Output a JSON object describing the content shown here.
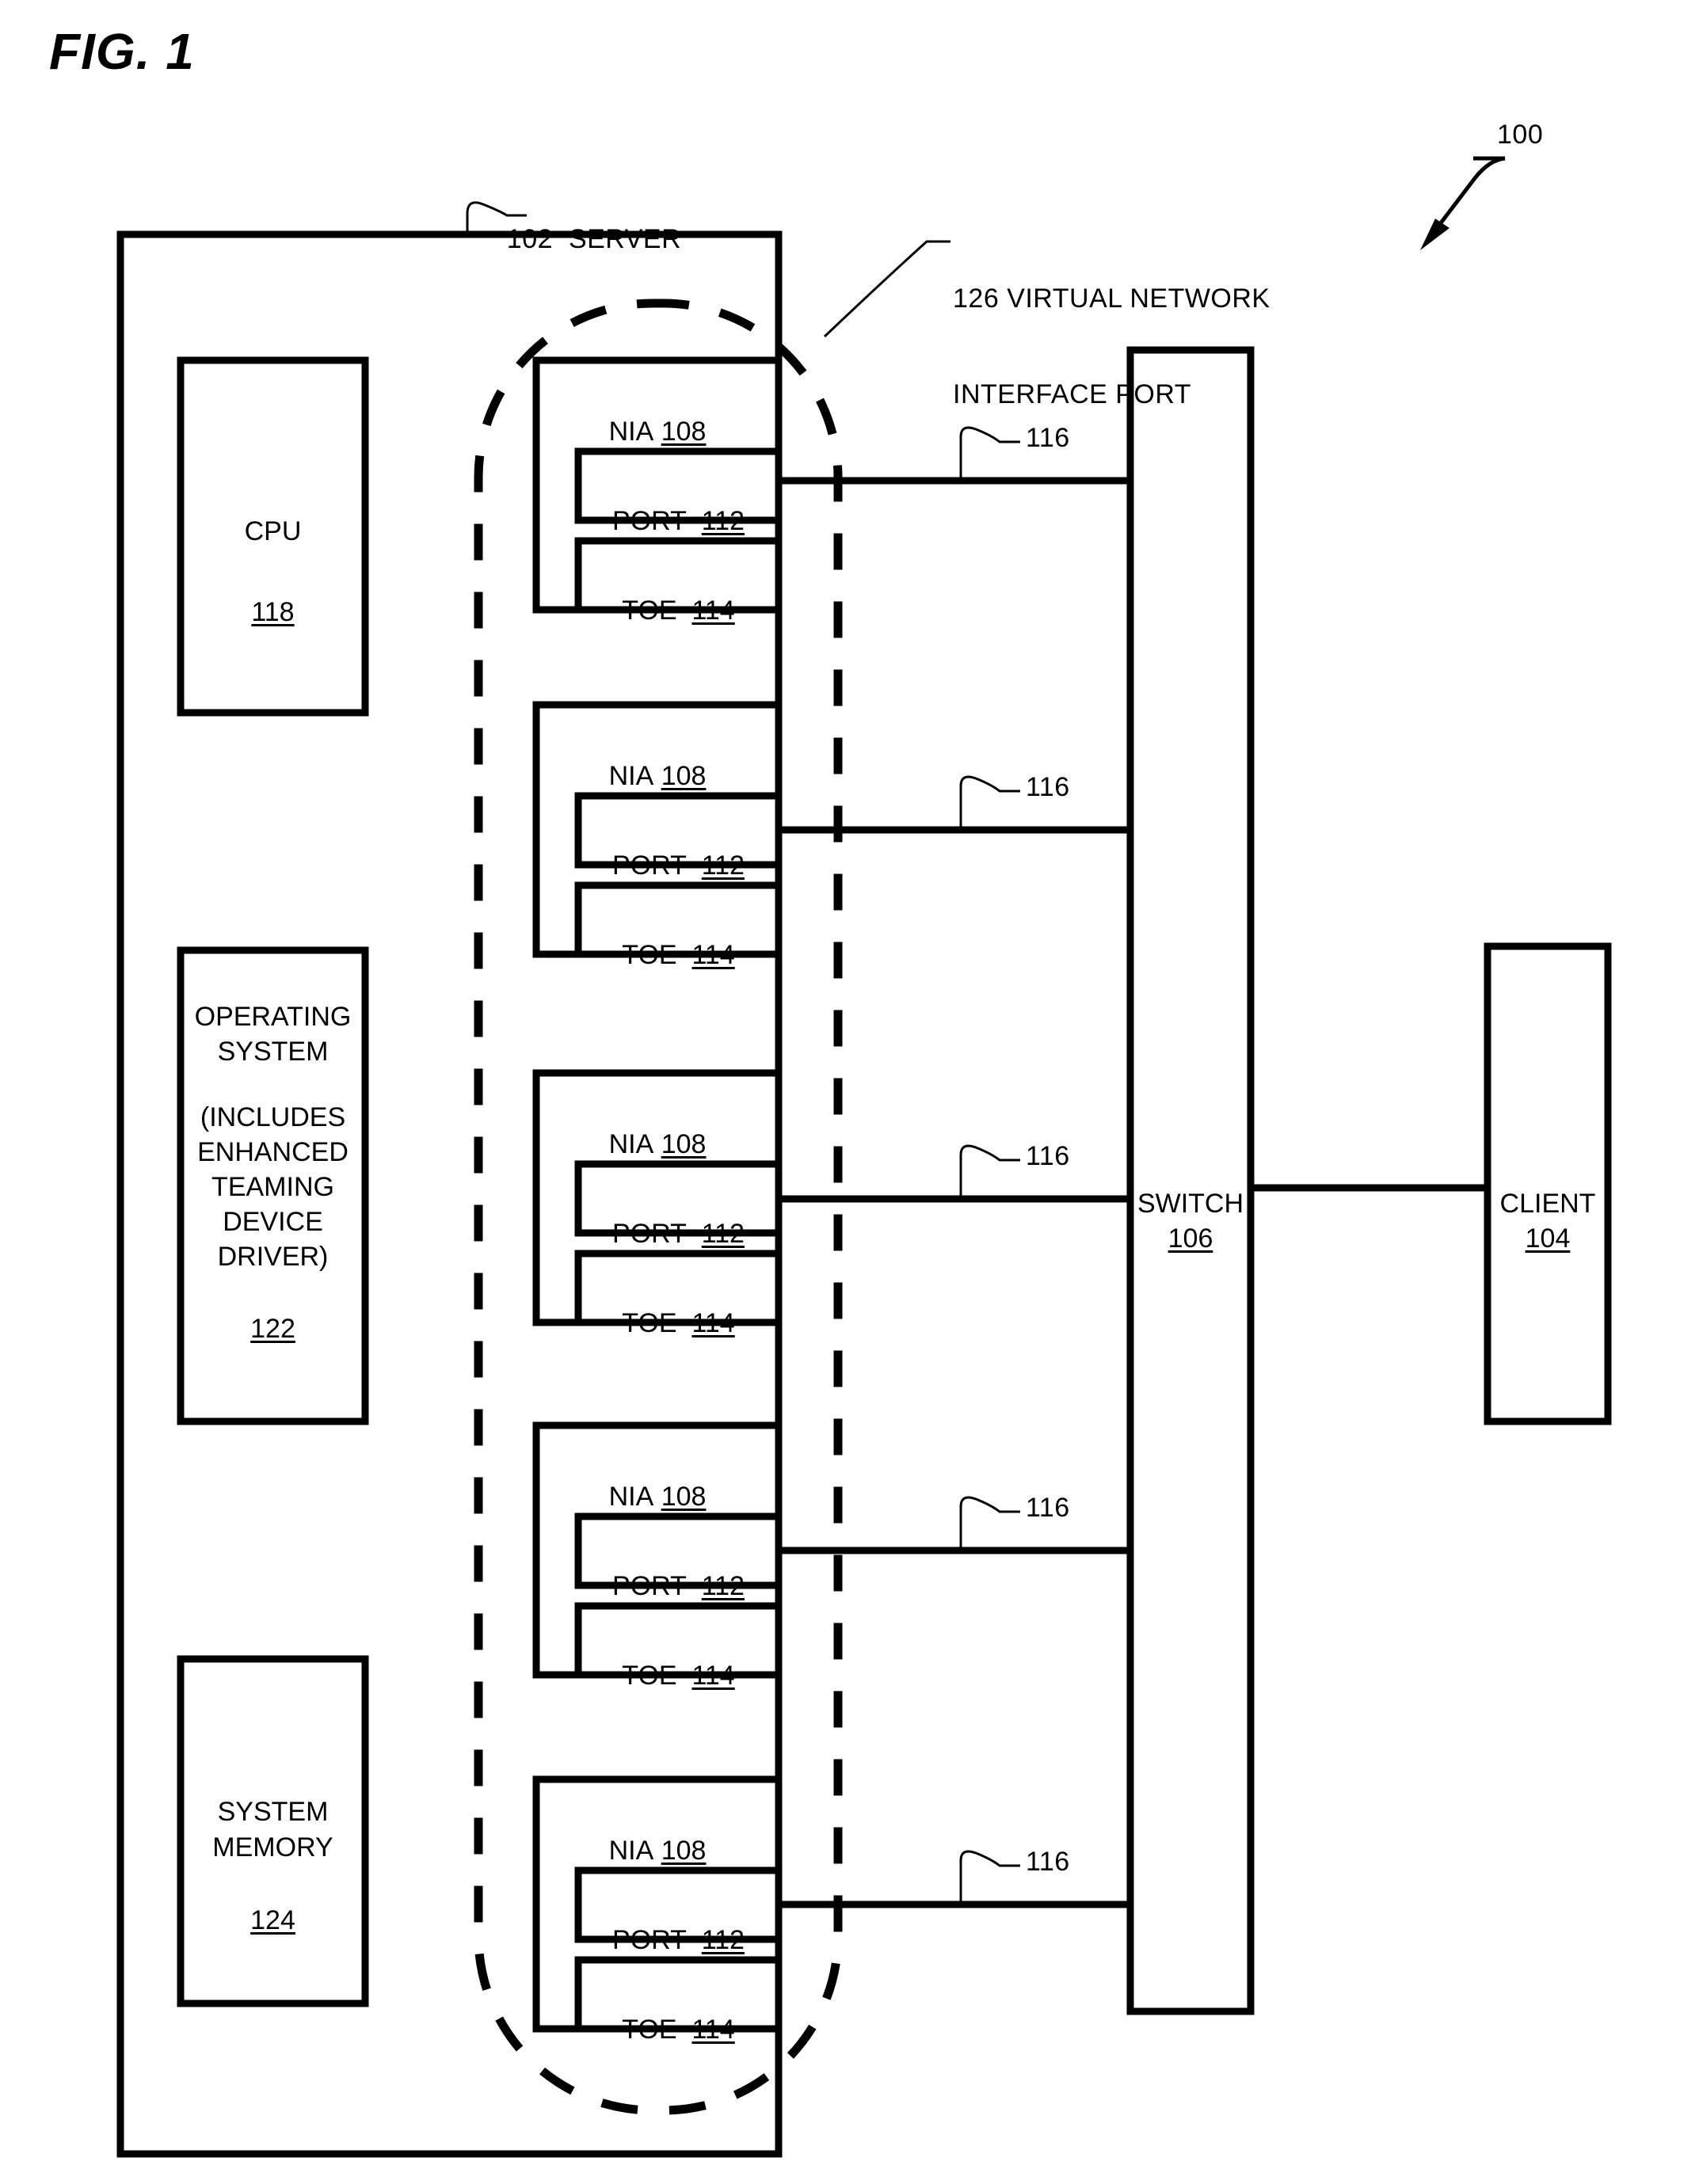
{
  "figure": {
    "label": "FIG. 1",
    "system_ref": "100"
  },
  "callouts": {
    "server": {
      "ref": "102",
      "text": "SERVER"
    },
    "vnip": {
      "ref": "126",
      "line1": "VIRTUAL NETWORK",
      "line2": "INTERFACE PORT"
    }
  },
  "server": {
    "cpu": {
      "label": "CPU",
      "ref": "118"
    },
    "os": {
      "line1": "OPERATING",
      "line2": "SYSTEM",
      "line3": "(INCLUDES",
      "line4": "ENHANCED",
      "line5": "TEAMING",
      "line6": "DEVICE",
      "line7": "DRIVER)",
      "ref": "122"
    },
    "memory": {
      "line1": "SYSTEM",
      "line2": "MEMORY",
      "ref": "124"
    },
    "nias": [
      {
        "label": "NIA",
        "ref": "108",
        "port": {
          "label": "PORT",
          "ref": "112"
        },
        "toe": {
          "label": "TOE",
          "ref": "114"
        },
        "link_ref": "116"
      },
      {
        "label": "NIA",
        "ref": "108",
        "port": {
          "label": "PORT",
          "ref": "112"
        },
        "toe": {
          "label": "TOE",
          "ref": "114"
        },
        "link_ref": "116"
      },
      {
        "label": "NIA",
        "ref": "108",
        "port": {
          "label": "PORT",
          "ref": "112"
        },
        "toe": {
          "label": "TOE",
          "ref": "114"
        },
        "link_ref": "116"
      },
      {
        "label": "NIA",
        "ref": "108",
        "port": {
          "label": "PORT",
          "ref": "112"
        },
        "toe": {
          "label": "TOE",
          "ref": "114"
        },
        "link_ref": "116"
      },
      {
        "label": "NIA",
        "ref": "108",
        "port": {
          "label": "PORT",
          "ref": "112"
        },
        "toe": {
          "label": "TOE",
          "ref": "114"
        },
        "link_ref": "116"
      }
    ]
  },
  "network": {
    "switch": {
      "label": "SWITCH",
      "ref": "106"
    },
    "client": {
      "label": "CLIENT",
      "ref": "104"
    }
  },
  "colors": {
    "ink": "#000000",
    "paper": "#ffffff"
  }
}
